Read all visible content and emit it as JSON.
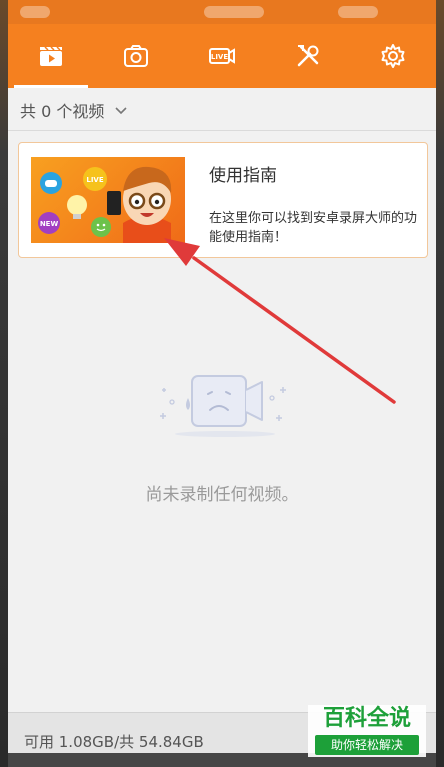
{
  "toolbar": {
    "tabs": [
      {
        "icon": "video-list-icon",
        "active": true
      },
      {
        "icon": "camera-icon",
        "active": false
      },
      {
        "icon": "live-icon",
        "active": false
      },
      {
        "icon": "tools-icon",
        "active": false
      },
      {
        "icon": "settings-icon",
        "active": false
      }
    ],
    "live_badge": "LIVE"
  },
  "video_count": {
    "label": "共 0 个视频"
  },
  "guide": {
    "title": "使用指南",
    "description": "在这里你可以找到安卓录屏大师的功能使用指南！",
    "thumb_badges": [
      "LIVE",
      "NEW"
    ]
  },
  "empty_state": {
    "message": "尚未录制任何视频。"
  },
  "storage": {
    "text": "可用 1.08GB/共 54.84GB"
  },
  "watermark": {
    "title": "百科全说",
    "subtitle": "助你轻松解决"
  },
  "colors": {
    "brand_orange": "#f5801f",
    "annotation_red": "#e03a3a",
    "watermark_green": "#1da039"
  }
}
